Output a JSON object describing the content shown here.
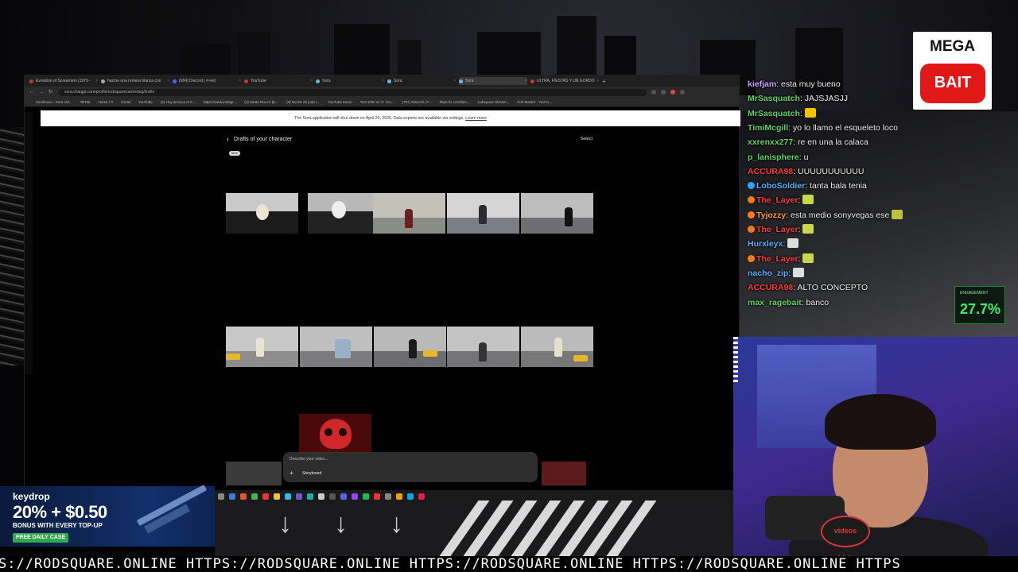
{
  "browser": {
    "tabs": [
      {
        "label": "Evolution of Screamers (1970 -"
      },
      {
        "label": "hazme una remera blanca con"
      },
      {
        "label": "(684) Discord | #-red"
      },
      {
        "label": "YouTube"
      },
      {
        "label": "Sora"
      },
      {
        "label": "Sora"
      },
      {
        "label": "Sora"
      },
      {
        "label": "ULTRA, FIESTAS Y UN GORDO"
      }
    ],
    "url": "sora.chatgpt.com/profile/rodsquarecam/edog/drafts",
    "bookmarks": [
      "Scrollovvo - Sora Vid...",
      "TikTok",
      "Home / X",
      "Gmail",
      "YouTube",
      "(2) Hoy arranca el C...",
      "https://www.instagr...",
      "(1) Santo Rox IV (E...",
      "(3) Noche de joda t...",
      "YouTube Music",
      "Tom Dilm on X: \"Co...",
      "(787) Discord | #...",
      "https://x.com/fam...",
      "rodsquare Stream...",
      "Fort Master - YouTu..."
    ]
  },
  "sora": {
    "banner_text": "The Sora application will shut down on April 26, 2026. Data exports are available via settings.",
    "banner_link": "Learn more",
    "page_title": "Drafts of your character",
    "select_label": "Select",
    "new_badge": "NEW",
    "prompt_placeholder": "Describe your video...",
    "storyboard_label": "Storyboard",
    "colors": {
      "accent": "#ffffff",
      "background": "#000000"
    }
  },
  "ad": {
    "brand": "keydrop",
    "headline": "20% + $0.50",
    "subline": "BONUS WITH EVERY TOP-UP",
    "cta": "FREE DAILY CASE"
  },
  "ticker": {
    "text": "S://RODSQUARE.ONLINE HTTPS://RODSQUARE.ONLINE HTTPS://RODSQUARE.ONLINE HTTPS://RODSQUARE.ONLINE HTTPS"
  },
  "overlay": {
    "logo_top": "MEGA",
    "logo_bottom": "BAIT",
    "engagement_label": "ENGAGEMENT",
    "engagement_value": "27.7%"
  },
  "chat": [
    {
      "user": "kiefjam",
      "color": "#c9a4ff",
      "text": ": esta muy bueno"
    },
    {
      "user": "MrSasquatch",
      "color": "#5fd35f",
      "text": ": JAJSJASJJ"
    },
    {
      "user": "MrSasquatch",
      "color": "#5fd35f",
      "text": ":"
    },
    {
      "user": "TimiMcgill",
      "color": "#5fd35f",
      "text": ": yo lo llamo el esqueleto loco"
    },
    {
      "user": "xxrenxx277",
      "color": "#5fd35f",
      "text": ": re en una la calaca"
    },
    {
      "user": "p_lanisphere",
      "color": "#5fd35f",
      "text": ": u"
    },
    {
      "user": "ACCURA98",
      "color": "#ff3a3a",
      "text": ": UUUUUUUUUUU"
    },
    {
      "user": "LoboSoldier",
      "color": "#5ab0ff",
      "text": ": tanta bala tenia"
    },
    {
      "user": "The_Layer",
      "color": "#ff3a3a",
      "text": ":"
    },
    {
      "user": "Tyjozzy",
      "color": "#ff9a3a",
      "text": ": esta medio sonyvegas ese"
    },
    {
      "user": "The_Layer",
      "color": "#ff3a3a",
      "text": ":"
    },
    {
      "user": "Hurxleyx",
      "color": "#5ab0ff",
      "text": ":"
    },
    {
      "user": "The_Layer",
      "color": "#ff3a3a",
      "text": ":"
    },
    {
      "user": "nacho_zip",
      "color": "#5ab0ff",
      "text": ":"
    },
    {
      "user": "ACCURA98",
      "color": "#ff3a3a",
      "text": ": ALTO CONCEPTO"
    },
    {
      "user": "max_ragebait",
      "color": "#5fd35f",
      "text": ": banco"
    }
  ],
  "webcam": {
    "mic_sticker": "videos chiabe"
  }
}
